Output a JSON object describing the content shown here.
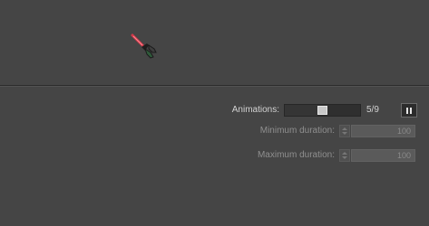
{
  "animations": {
    "label": "Animations:",
    "current": 5,
    "total": 9,
    "counter_text": "5/9",
    "slider_fraction": 0.5
  },
  "pause_button": {
    "icon": "pause-icon"
  },
  "min_duration": {
    "label": "Minimum duration:",
    "value": "100"
  },
  "max_duration": {
    "label": "Maximum duration:",
    "value": "100"
  },
  "colors": {
    "background": "#454545",
    "sprite_blade": "#d23a4a",
    "sprite_hilt": "#2f5a3a"
  }
}
